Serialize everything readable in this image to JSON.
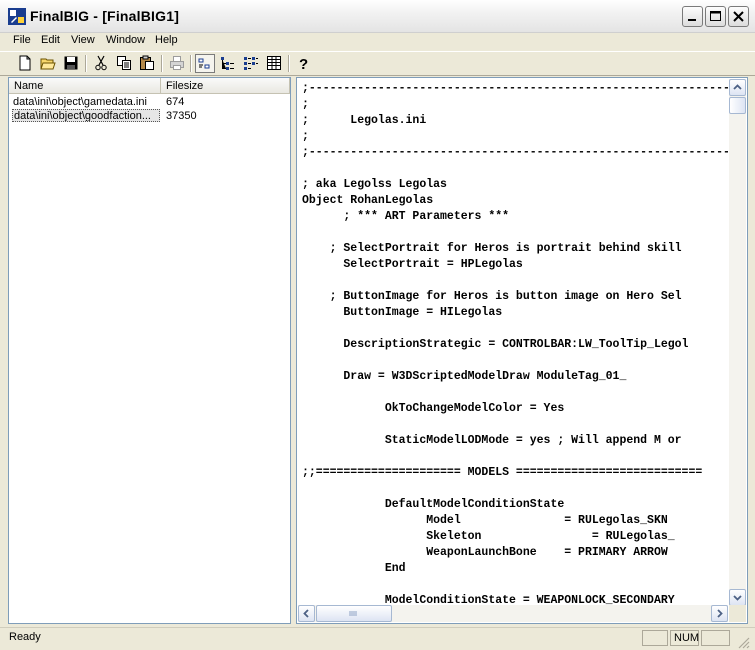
{
  "window": {
    "title": "FinalBIG - [FinalBIG1]"
  },
  "menu": [
    "File",
    "Edit",
    "View",
    "Window",
    "Help"
  ],
  "toolbar": {
    "buttons": [
      "new-file",
      "open-folder",
      "save",
      "cut",
      "copy",
      "paste",
      "print",
      "view-small-icons",
      "view-tree",
      "view-list",
      "view-details",
      "help"
    ],
    "active": "view-small-icons"
  },
  "file_list": {
    "columns": [
      "Name",
      "Filesize"
    ],
    "rows": [
      {
        "name": "data\\ini\\object\\gamedata.ini",
        "size": "674",
        "selected": false
      },
      {
        "name": "data\\ini\\object\\goodfaction...",
        "size": "37350",
        "selected": true
      }
    ]
  },
  "editor": {
    "lines": [
      ";------------------------------------------------------------------------",
      ";",
      ";      Legolas.ini",
      ";",
      ";------------------------------------------------------------------------",
      "",
      "; aka Legolss Legolas",
      "Object RohanLegolas",
      "      ; *** ART Parameters ***",
      "",
      "    ; SelectPortrait for Heros is portrait behind skill",
      "      SelectPortrait = HPLegolas",
      "",
      "    ; ButtonImage for Heros is button image on Hero Sel",
      "      ButtonImage = HILegolas",
      "",
      "      DescriptionStrategic = CONTROLBAR:LW_ToolTip_Legol",
      "",
      "      Draw = W3DScriptedModelDraw ModuleTag_01_",
      "",
      "            OkToChangeModelColor = Yes",
      "",
      "            StaticModelLODMode = yes ; Will append M or",
      "",
      ";;===================== MODELS ===========================",
      "",
      "            DefaultModelConditionState",
      "                  Model               = RULegolas_SKN",
      "                  Skeleton                = RULegolas_",
      "                  WeaponLaunchBone    = PRIMARY ARROW",
      "            End",
      "",
      "            ModelConditionState = WEAPONLOCK_SECONDARY"
    ]
  },
  "status": {
    "text": "Ready",
    "num": "NUM"
  }
}
